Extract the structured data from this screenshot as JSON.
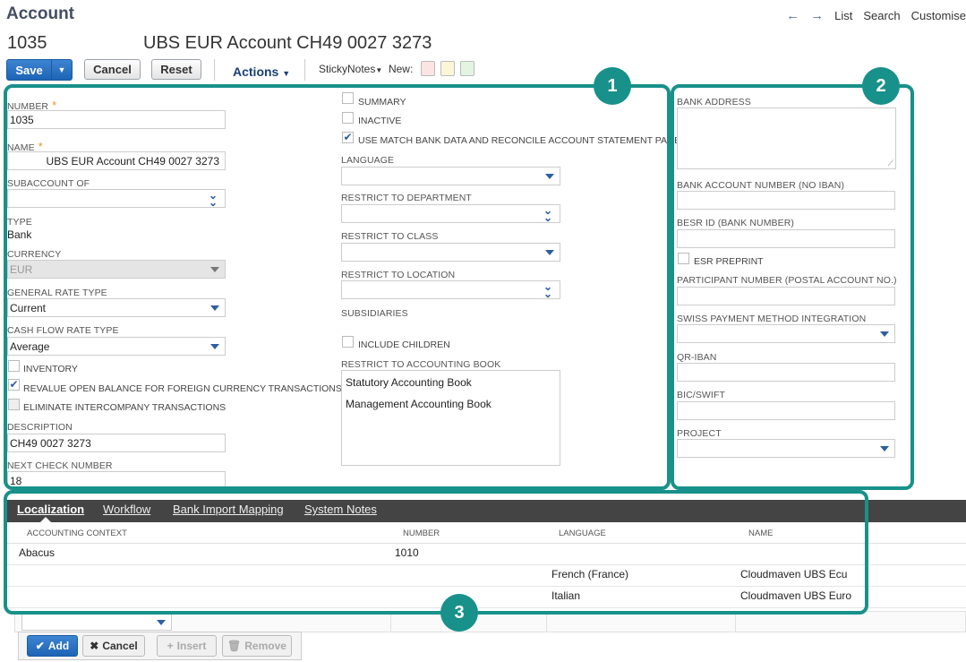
{
  "header": {
    "title": "Account",
    "account_number": "1035",
    "account_name": "UBS EUR Account CH49 0027 3273",
    "nav": {
      "back": "←",
      "forward": "→",
      "list": "List",
      "search": "Search",
      "customise": "Customise"
    }
  },
  "toolbar": {
    "save": "Save",
    "cancel": "Cancel",
    "reset": "Reset",
    "actions": "Actions",
    "sticky_notes": "StickyNotes",
    "new_label": "New:",
    "swatch_colors": [
      "#fde4e4",
      "#fdf6d6",
      "#e3f5e0"
    ]
  },
  "form": {
    "number": {
      "label": "NUMBER",
      "value": "1035"
    },
    "name": {
      "label": "NAME",
      "value": "UBS EUR Account CH49 0027 3273"
    },
    "subaccount_of": {
      "label": "SUBACCOUNT OF",
      "value": ""
    },
    "type": {
      "label": "TYPE",
      "value": "Bank"
    },
    "currency": {
      "label": "CURRENCY",
      "value": "EUR"
    },
    "general_rate_type": {
      "label": "GENERAL RATE TYPE",
      "value": "Current"
    },
    "cash_flow_rate_type": {
      "label": "CASH FLOW RATE TYPE",
      "value": "Average"
    },
    "inventory": {
      "label": "INVENTORY",
      "checked": false
    },
    "revalue": {
      "label": "REVALUE OPEN BALANCE FOR FOREIGN CURRENCY TRANSACTIONS",
      "checked": true
    },
    "eliminate": {
      "label": "ELIMINATE INTERCOMPANY TRANSACTIONS",
      "checked": false
    },
    "description": {
      "label": "DESCRIPTION",
      "value": "CH49 0027 3273"
    },
    "next_check_number": {
      "label": "NEXT CHECK NUMBER",
      "value": "18"
    },
    "summary": {
      "label": "SUMMARY",
      "checked": false
    },
    "inactive": {
      "label": "INACTIVE",
      "checked": false
    },
    "use_match": {
      "label": "USE MATCH BANK DATA AND RECONCILE ACCOUNT STATEMENT PAGES",
      "checked": true
    },
    "language": {
      "label": "LANGUAGE",
      "value": ""
    },
    "restrict_department": {
      "label": "RESTRICT TO DEPARTMENT",
      "value": ""
    },
    "restrict_class": {
      "label": "RESTRICT TO CLASS",
      "value": ""
    },
    "restrict_location": {
      "label": "RESTRICT TO LOCATION",
      "value": ""
    },
    "subsidiaries": {
      "label": "SUBSIDIARIES"
    },
    "include_children": {
      "label": "INCLUDE CHILDREN",
      "checked": false
    },
    "restrict_accounting_book": {
      "label": "RESTRICT TO ACCOUNTING BOOK",
      "options": [
        "Statutory Accounting Book",
        "Management Accounting Book"
      ]
    },
    "bank_address": {
      "label": "BANK ADDRESS",
      "value": ""
    },
    "bank_account_number": {
      "label": "BANK ACCOUNT NUMBER (NO IBAN)",
      "value": ""
    },
    "besr_id": {
      "label": "BESR ID (BANK NUMBER)",
      "value": ""
    },
    "esr_preprint": {
      "label": "ESR PREPRINT",
      "checked": false
    },
    "participant_number": {
      "label": "PARTICIPANT NUMBER (POSTAL ACCOUNT NO.)",
      "value": ""
    },
    "swiss_payment": {
      "label": "SWISS PAYMENT METHOD INTEGRATION",
      "value": ""
    },
    "qr_iban": {
      "label": "QR-IBAN",
      "value": ""
    },
    "bic_swift": {
      "label": "BIC/SWIFT",
      "value": ""
    },
    "project": {
      "label": "PROJECT",
      "value": ""
    }
  },
  "callouts": {
    "one": "1",
    "two": "2",
    "three": "3",
    "color": "#18918a"
  },
  "tabs": [
    "Localization",
    "Workflow",
    "Bank Import Mapping",
    "System Notes"
  ],
  "table": {
    "headers": [
      "ACCOUNTING CONTEXT",
      "NUMBER",
      "LANGUAGE",
      "NAME"
    ],
    "rows": [
      [
        "Abacus",
        "1010",
        "",
        ""
      ],
      [
        "",
        "",
        "French (France)",
        "Cloudmaven UBS Ecu"
      ],
      [
        "",
        "",
        "Italian",
        "Cloudmaven UBS Euro"
      ]
    ]
  },
  "line_buttons": {
    "add": "Add",
    "cancel": "Cancel",
    "insert": "Insert",
    "remove": "Remove"
  }
}
